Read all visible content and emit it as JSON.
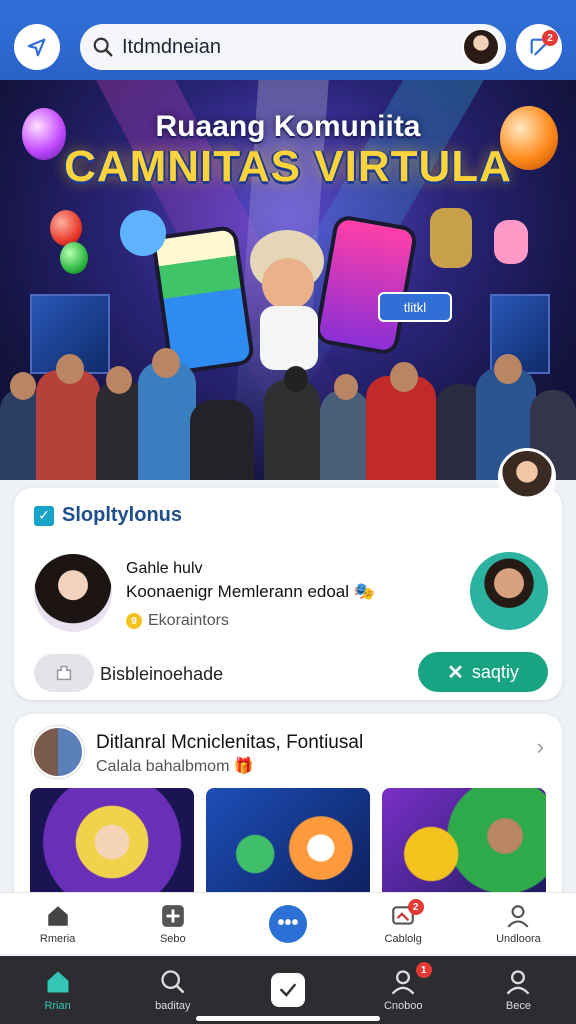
{
  "topbar": {
    "search_value": "Itdmdneian"
  },
  "hero": {
    "title_line1": "Ruaang Komuniita",
    "title_line2": "CAMNITAS VIRTULA",
    "phone_chip": "tlitkl"
  },
  "card1": {
    "title": "Slopltylonus",
    "name": "Gahle hulv",
    "subtitle": "Koonaenigr Memlerann edoal",
    "meta": "Ekoraintors",
    "secondary_label": "Bisbleinoehade",
    "primary_button": "saqtiy"
  },
  "card2": {
    "title": "Ditlanral Mcniclenitas, Fontiusal",
    "subtitle": "Calala bahalbmom"
  },
  "nav_top": [
    {
      "label": "Rmeria",
      "icon": "home-icon"
    },
    {
      "label": "Sebo",
      "icon": "plus-square-icon"
    },
    {
      "label": "",
      "icon": "more-dots-icon"
    },
    {
      "label": "Cablolg",
      "icon": "message-icon",
      "badge": "2"
    },
    {
      "label": "Undloora",
      "icon": "user-icon"
    }
  ],
  "nav_bottom": [
    {
      "label": "Rrian",
      "icon": "home-icon"
    },
    {
      "label": "baditay",
      "icon": "search-icon"
    },
    {
      "label": "",
      "icon": "check-icon"
    },
    {
      "label": "Cnoboo",
      "icon": "users-icon",
      "badge": "1"
    },
    {
      "label": "Bece",
      "icon": "user-icon"
    }
  ],
  "notifications_badge": "2",
  "colors": {
    "primary": "#2f6fd6",
    "accent_green": "#18a383",
    "badge_red": "#e53935",
    "title_yellow": "#ffd43b",
    "nav_dark": "#2b2d31"
  }
}
